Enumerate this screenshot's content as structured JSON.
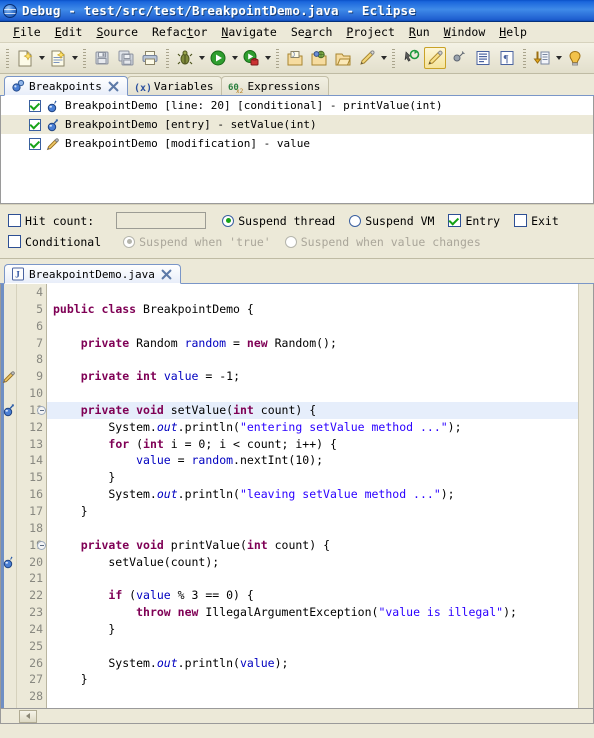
{
  "window": {
    "title": "Debug - test/src/test/BreakpointDemo.java - Eclipse",
    "app_icon": "eclipse-globe-icon"
  },
  "menubar": {
    "items": [
      {
        "label": "File",
        "mnemonic": "F"
      },
      {
        "label": "Edit",
        "mnemonic": "E"
      },
      {
        "label": "Source",
        "mnemonic": "S"
      },
      {
        "label": "Refactor",
        "mnemonic": "t"
      },
      {
        "label": "Navigate",
        "mnemonic": "N"
      },
      {
        "label": "Search",
        "mnemonic": "a"
      },
      {
        "label": "Project",
        "mnemonic": "P"
      },
      {
        "label": "Run",
        "mnemonic": "R"
      },
      {
        "label": "Window",
        "mnemonic": "W"
      },
      {
        "label": "Help",
        "mnemonic": "H"
      }
    ]
  },
  "toolbar": {
    "groups": [
      {
        "buttons": [
          {
            "icon": "new-java-file-icon",
            "dropdown": true
          },
          {
            "icon": "new-java-class-icon",
            "dropdown": true
          }
        ]
      },
      {
        "buttons": [
          {
            "icon": "save-icon",
            "dropdown": false
          },
          {
            "icon": "save-all-icon",
            "dropdown": false
          },
          {
            "icon": "print-icon",
            "dropdown": false
          }
        ]
      },
      {
        "buttons": [
          {
            "icon": "debug-icon",
            "dropdown": true
          },
          {
            "icon": "run-icon",
            "dropdown": true
          },
          {
            "icon": "external-tools-icon",
            "dropdown": true
          }
        ]
      },
      {
        "buttons": [
          {
            "icon": "open-type-icon",
            "dropdown": false
          },
          {
            "icon": "search-icon",
            "dropdown": false
          },
          {
            "icon": "open-resource-icon",
            "dropdown": false
          },
          {
            "icon": "pencil-marker-icon",
            "dropdown": true
          }
        ]
      },
      {
        "buttons": [
          {
            "icon": "next-annotation-icon",
            "dropdown": false
          },
          {
            "icon": "toggle-mark-occurrences-icon",
            "dropdown": false,
            "active": true
          },
          {
            "icon": "previous-annotation-icon",
            "dropdown": false
          },
          {
            "icon": "show-whitespace-icon",
            "dropdown": false
          },
          {
            "icon": "paragraph-marks-icon",
            "dropdown": false
          }
        ]
      },
      {
        "buttons": [
          {
            "icon": "step-into-selection-icon",
            "dropdown": true
          },
          {
            "icon": "back-navigation-icon",
            "dropdown": false
          }
        ]
      }
    ]
  },
  "breakpoints_view": {
    "tabs": [
      {
        "label": "Breakpoints",
        "icon": "breakpoints-icon",
        "selected": true,
        "closable": true
      },
      {
        "label": "Variables",
        "icon": "variables-icon",
        "selected": false,
        "closable": false
      },
      {
        "label": "Expressions",
        "icon": "expressions-icon",
        "selected": false,
        "closable": false
      }
    ],
    "rows": [
      {
        "checked": true,
        "icon": "conditional-breakpoint-icon",
        "label": "BreakpointDemo [line: 20] [conditional] - printValue(int)",
        "selected": false
      },
      {
        "checked": true,
        "icon": "method-entry-breakpoint-icon",
        "label": "BreakpointDemo [entry] - setValue(int)",
        "selected": true
      },
      {
        "checked": true,
        "icon": "watchpoint-icon",
        "label": "BreakpointDemo [modification] - value",
        "selected": false
      }
    ]
  },
  "properties": {
    "hit_count": {
      "label": "Hit count:",
      "checked": false,
      "value": "",
      "enabled": true
    },
    "suspend_thread": {
      "label": "Suspend thread",
      "selected": true
    },
    "suspend_vm": {
      "label": "Suspend VM",
      "selected": false
    },
    "entry": {
      "label": "Entry",
      "checked": true
    },
    "exit": {
      "label": "Exit",
      "checked": false
    },
    "conditional": {
      "label": "Conditional",
      "checked": false
    },
    "suspend_when_true": {
      "label": "Suspend when 'true'",
      "selected": true,
      "enabled": false
    },
    "suspend_when_value_changes": {
      "label": "Suspend when value changes",
      "selected": false,
      "enabled": false
    }
  },
  "editor": {
    "tabs": [
      {
        "label": "BreakpointDemo.java",
        "icon": "java-file-icon",
        "selected": true,
        "closable": true
      }
    ],
    "first_line": 4,
    "highlighted_line": 11,
    "markers": [
      {
        "line": 9,
        "type": "watchpoint-icon"
      },
      {
        "line": 11,
        "type": "method-entry-breakpoint-icon"
      },
      {
        "line": 20,
        "type": "conditional-breakpoint-icon"
      }
    ],
    "fold_lines": [
      11,
      19
    ],
    "lines": [
      {
        "n": 4,
        "tokens": []
      },
      {
        "n": 5,
        "tokens": [
          {
            "t": "kw",
            "s": "public"
          },
          {
            "t": "p",
            "s": " "
          },
          {
            "t": "kw",
            "s": "class"
          },
          {
            "t": "p",
            "s": " BreakpointDemo {"
          }
        ]
      },
      {
        "n": 6,
        "tokens": []
      },
      {
        "n": 7,
        "tokens": [
          {
            "t": "p",
            "s": "    "
          },
          {
            "t": "kw",
            "s": "private"
          },
          {
            "t": "p",
            "s": " Random "
          },
          {
            "t": "fld",
            "s": "random"
          },
          {
            "t": "p",
            "s": " = "
          },
          {
            "t": "kw",
            "s": "new"
          },
          {
            "t": "p",
            "s": " Random();"
          }
        ]
      },
      {
        "n": 8,
        "tokens": []
      },
      {
        "n": 9,
        "tokens": [
          {
            "t": "p",
            "s": "    "
          },
          {
            "t": "kw",
            "s": "private"
          },
          {
            "t": "p",
            "s": " "
          },
          {
            "t": "kw",
            "s": "int"
          },
          {
            "t": "p",
            "s": " "
          },
          {
            "t": "fld",
            "s": "value"
          },
          {
            "t": "p",
            "s": " = -1;"
          }
        ]
      },
      {
        "n": 10,
        "tokens": []
      },
      {
        "n": 11,
        "tokens": [
          {
            "t": "p",
            "s": "    "
          },
          {
            "t": "kw",
            "s": "private"
          },
          {
            "t": "p",
            "s": " "
          },
          {
            "t": "kw",
            "s": "void"
          },
          {
            "t": "p",
            "s": " setValue("
          },
          {
            "t": "kw",
            "s": "int"
          },
          {
            "t": "p",
            "s": " count) {"
          }
        ]
      },
      {
        "n": 12,
        "tokens": [
          {
            "t": "p",
            "s": "        System."
          },
          {
            "t": "sfld",
            "s": "out"
          },
          {
            "t": "p",
            "s": ".println("
          },
          {
            "t": "str",
            "s": "\"entering setValue method ...\""
          },
          {
            "t": "p",
            "s": ");"
          }
        ]
      },
      {
        "n": 13,
        "tokens": [
          {
            "t": "p",
            "s": "        "
          },
          {
            "t": "kw",
            "s": "for"
          },
          {
            "t": "p",
            "s": " ("
          },
          {
            "t": "kw",
            "s": "int"
          },
          {
            "t": "p",
            "s": " i = 0; i < count; i++) {"
          }
        ]
      },
      {
        "n": 14,
        "tokens": [
          {
            "t": "p",
            "s": "            "
          },
          {
            "t": "fld",
            "s": "value"
          },
          {
            "t": "p",
            "s": " = "
          },
          {
            "t": "fld",
            "s": "random"
          },
          {
            "t": "p",
            "s": ".nextInt(10);"
          }
        ]
      },
      {
        "n": 15,
        "tokens": [
          {
            "t": "p",
            "s": "        }"
          }
        ]
      },
      {
        "n": 16,
        "tokens": [
          {
            "t": "p",
            "s": "        System."
          },
          {
            "t": "sfld",
            "s": "out"
          },
          {
            "t": "p",
            "s": ".println("
          },
          {
            "t": "str",
            "s": "\"leaving setValue method ...\""
          },
          {
            "t": "p",
            "s": ");"
          }
        ]
      },
      {
        "n": 17,
        "tokens": [
          {
            "t": "p",
            "s": "    }"
          }
        ]
      },
      {
        "n": 18,
        "tokens": []
      },
      {
        "n": 19,
        "tokens": [
          {
            "t": "p",
            "s": "    "
          },
          {
            "t": "kw",
            "s": "private"
          },
          {
            "t": "p",
            "s": " "
          },
          {
            "t": "kw",
            "s": "void"
          },
          {
            "t": "p",
            "s": " printValue("
          },
          {
            "t": "kw",
            "s": "int"
          },
          {
            "t": "p",
            "s": " count) {"
          }
        ]
      },
      {
        "n": 20,
        "tokens": [
          {
            "t": "p",
            "s": "        setValue(count);"
          }
        ]
      },
      {
        "n": 21,
        "tokens": []
      },
      {
        "n": 22,
        "tokens": [
          {
            "t": "p",
            "s": "        "
          },
          {
            "t": "kw",
            "s": "if"
          },
          {
            "t": "p",
            "s": " ("
          },
          {
            "t": "fld",
            "s": "value"
          },
          {
            "t": "p",
            "s": " % 3 == 0) {"
          }
        ]
      },
      {
        "n": 23,
        "tokens": [
          {
            "t": "p",
            "s": "            "
          },
          {
            "t": "kw",
            "s": "throw"
          },
          {
            "t": "p",
            "s": " "
          },
          {
            "t": "kw",
            "s": "new"
          },
          {
            "t": "p",
            "s": " IllegalArgumentException("
          },
          {
            "t": "str",
            "s": "\"value is illegal\""
          },
          {
            "t": "p",
            "s": ");"
          }
        ]
      },
      {
        "n": 24,
        "tokens": [
          {
            "t": "p",
            "s": "        }"
          }
        ]
      },
      {
        "n": 25,
        "tokens": []
      },
      {
        "n": 26,
        "tokens": [
          {
            "t": "p",
            "s": "        System."
          },
          {
            "t": "sfld",
            "s": "out"
          },
          {
            "t": "p",
            "s": ".println("
          },
          {
            "t": "fld",
            "s": "value"
          },
          {
            "t": "p",
            "s": ");"
          }
        ]
      },
      {
        "n": 27,
        "tokens": [
          {
            "t": "p",
            "s": "    }"
          }
        ]
      },
      {
        "n": 28,
        "tokens": []
      }
    ]
  },
  "colors": {
    "titlebar_blue": "#1a66dc",
    "chrome": "#ece9d8",
    "keyword": "#7f0055",
    "string": "#2a00ff",
    "field": "#0000c0",
    "line_highlight": "#e6eefb",
    "selection": "#ece9d8"
  }
}
